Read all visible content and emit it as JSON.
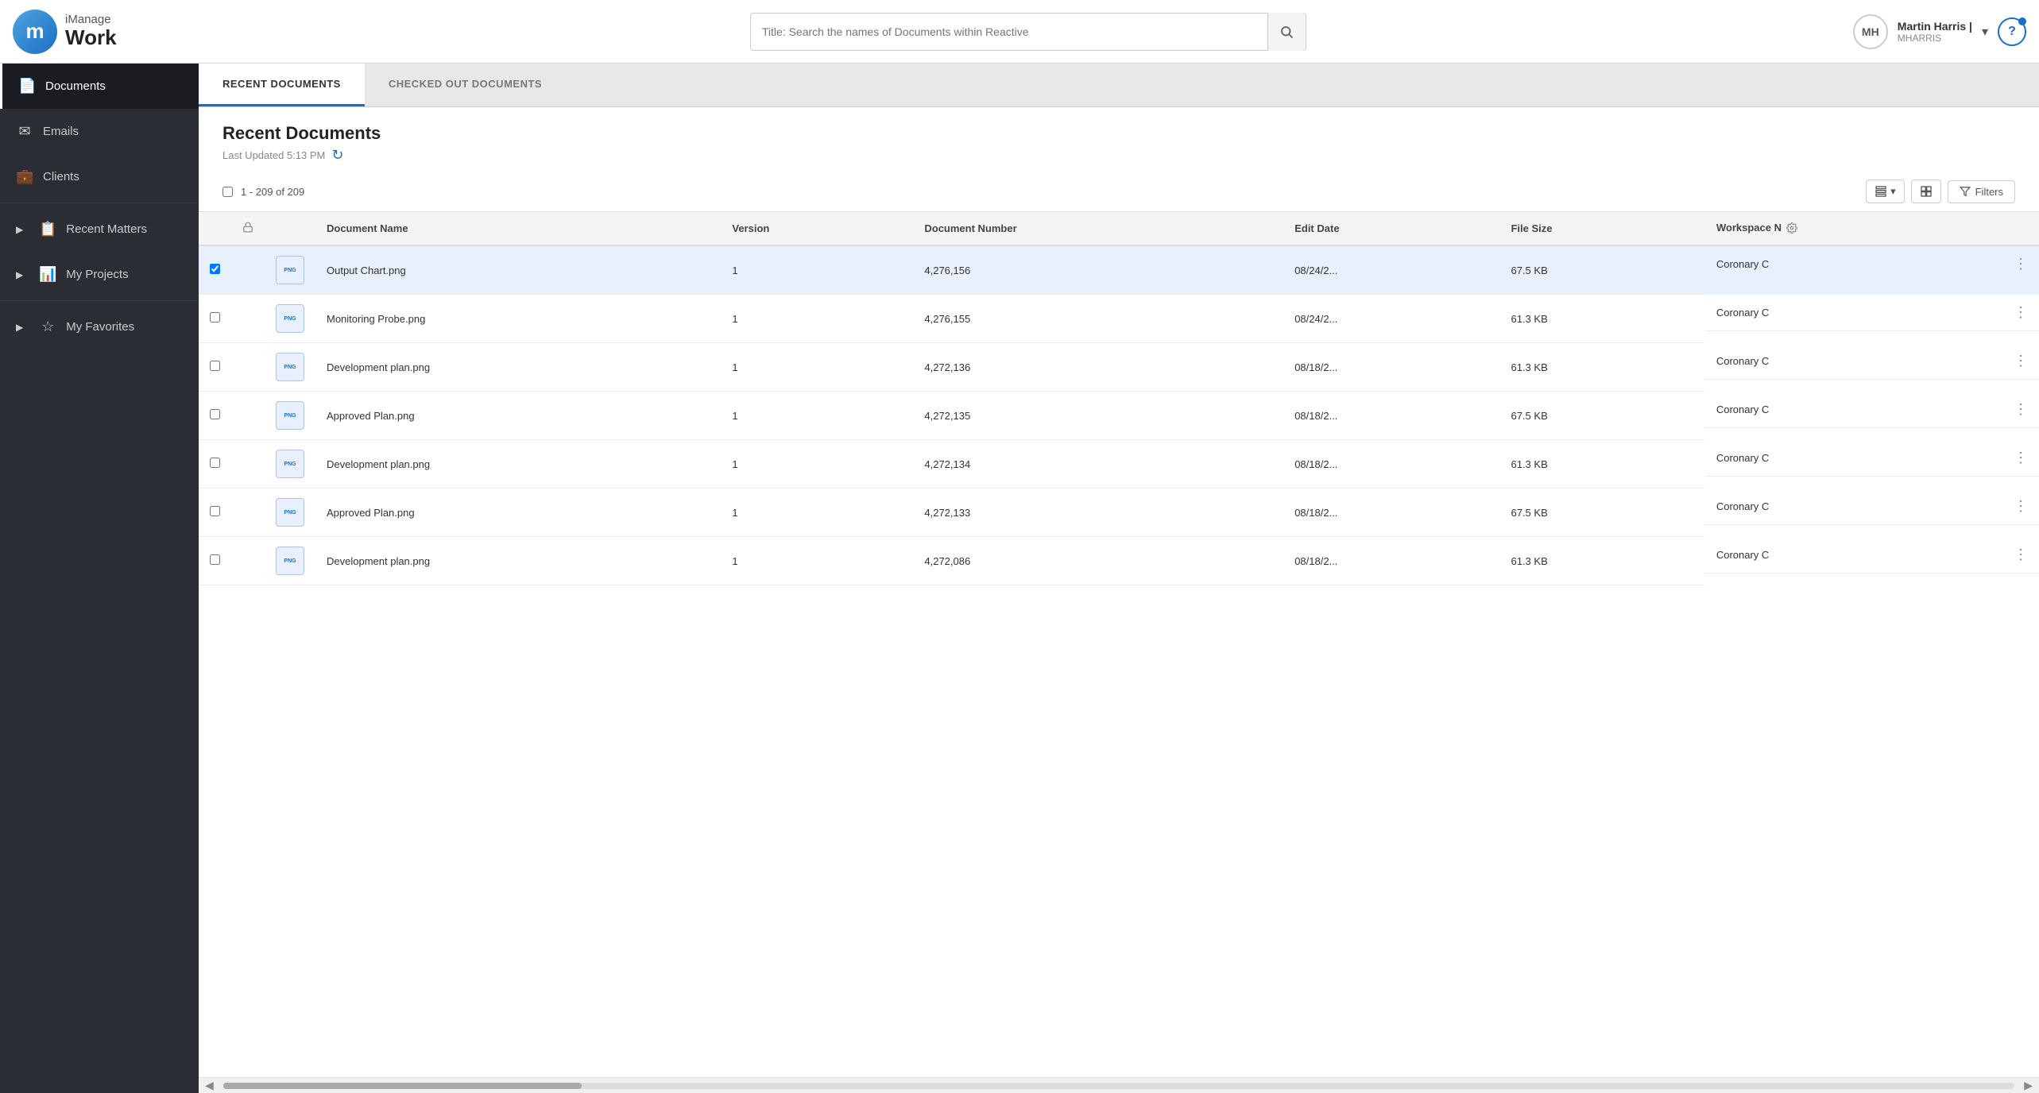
{
  "topbar": {
    "logo_letter": "m",
    "logo_brand": "iManage",
    "logo_product": "Work",
    "search_placeholder": "Title: Search the names of Documents within Reactive",
    "user_initials": "MH",
    "user_name": "Martin Harris |",
    "user_handle": "MHARRIS",
    "help_label": "?"
  },
  "sidebar": {
    "items": [
      {
        "id": "documents",
        "label": "Documents",
        "icon": "📄",
        "active": true
      },
      {
        "id": "emails",
        "label": "Emails",
        "icon": "✉",
        "active": false
      },
      {
        "id": "clients",
        "label": "Clients",
        "icon": "💼",
        "active": false
      },
      {
        "id": "recent-matters",
        "label": "Recent Matters",
        "icon": "📋",
        "active": false,
        "has_arrow": true
      },
      {
        "id": "my-projects",
        "label": "My Projects",
        "icon": "📊",
        "active": false,
        "has_arrow": true
      },
      {
        "id": "my-favorites",
        "label": "My Favorites",
        "icon": "☆",
        "active": false,
        "has_arrow": true
      }
    ]
  },
  "tabs": [
    {
      "id": "recent-documents",
      "label": "RECENT DOCUMENTS",
      "active": true
    },
    {
      "id": "checked-out-documents",
      "label": "CHECKED OUT DOCUMENTS",
      "active": false
    }
  ],
  "content": {
    "title": "Recent Documents",
    "last_updated_label": "Last Updated 5:13 PM",
    "record_count": "1 - 209 of 209",
    "filter_label": "Filters",
    "columns": {
      "document_name": "Document Name",
      "version": "Version",
      "document_number": "Document Number",
      "edit_date": "Edit Date",
      "file_size": "File Size",
      "workspace": "Workspace N"
    },
    "rows": [
      {
        "name": "Output Chart.png",
        "version": "1",
        "doc_number": "4,276,156",
        "edit_date": "08/24/2...",
        "file_size": "67.5 KB",
        "workspace": "Coronary C",
        "highlighted": true
      },
      {
        "name": "Monitoring Probe.png",
        "version": "1",
        "doc_number": "4,276,155",
        "edit_date": "08/24/2...",
        "file_size": "61.3 KB",
        "workspace": "Coronary C",
        "highlighted": false
      },
      {
        "name": "Development plan.png",
        "version": "1",
        "doc_number": "4,272,136",
        "edit_date": "08/18/2...",
        "file_size": "61.3 KB",
        "workspace": "Coronary C",
        "highlighted": false
      },
      {
        "name": "Approved Plan.png",
        "version": "1",
        "doc_number": "4,272,135",
        "edit_date": "08/18/2...",
        "file_size": "67.5 KB",
        "workspace": "Coronary C",
        "highlighted": false
      },
      {
        "name": "Development plan.png",
        "version": "1",
        "doc_number": "4,272,134",
        "edit_date": "08/18/2...",
        "file_size": "61.3 KB",
        "workspace": "Coronary C",
        "highlighted": false
      },
      {
        "name": "Approved Plan.png",
        "version": "1",
        "doc_number": "4,272,133",
        "edit_date": "08/18/2...",
        "file_size": "67.5 KB",
        "workspace": "Coronary C",
        "highlighted": false
      },
      {
        "name": "Development plan.png",
        "version": "1",
        "doc_number": "4,272,086",
        "edit_date": "08/18/2...",
        "file_size": "61.3 KB",
        "workspace": "Coronary C",
        "highlighted": false
      }
    ]
  }
}
